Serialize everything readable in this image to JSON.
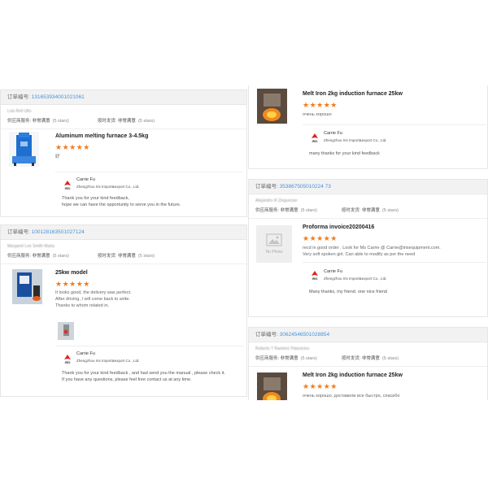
{
  "labels": {
    "order_prefix": "订单编号:",
    "service_label": "供应商服务:",
    "delivery_label": "按时发货:",
    "very_good": "非常满意",
    "five_stars": "(5 stars)",
    "star_glyphs": "★★★★★"
  },
  "seller": {
    "name": "Carrie Fu",
    "company": "Zhengzhou Iris Import&export Co., Ltd.",
    "logo_text": "IRIS"
  },
  "cards": [
    {
      "order_no": "131653934001021061",
      "buyer": "Luis Reil Ulto",
      "title": "Aluminum melting furnace 3-4.5kg",
      "comment": "好",
      "reply": "Thank you for your kind feedback,\nhope we can have the opportunity to serve you in the future."
    },
    {
      "order_no": "100128163501027124",
      "buyer": "Margaret Lee Smith Maria",
      "title": "25kw model",
      "comment": "It looks good, the delivery was perfect.\nAfter driving, I will come back to write.\nThanks to whom related in.",
      "reply": "Thank you for your kind feedback , and had send you the manual , please check it.\nIf you have any questions, please  feel free contact us at any time."
    },
    {
      "title": "Melt Iron 2kg induction furnace 25kw",
      "comment": "очень хорошо",
      "reply": "many thanks for your kind feedback"
    },
    {
      "order_no": "353867505010224 73",
      "buyer": "Alejandro III Zinguezan",
      "title": "Proforma invoice20200416",
      "no_photo": "No Photo",
      "comment": "recd in good  order . Look for Ms Carrie @ Carrie@irisequipment.com.\nVery soft spoken girl. Can able to modify as per the need",
      "reply": "Many thanks, my friend. one nice friend"
    },
    {
      "order_no": "30624546501028854",
      "buyer": "Roberto T Ramirez Palavicino",
      "title": "Melt Iron 2kg induction furnace 25kw",
      "comment": "очень хорошо. доставили все быстро, спасибо"
    }
  ]
}
